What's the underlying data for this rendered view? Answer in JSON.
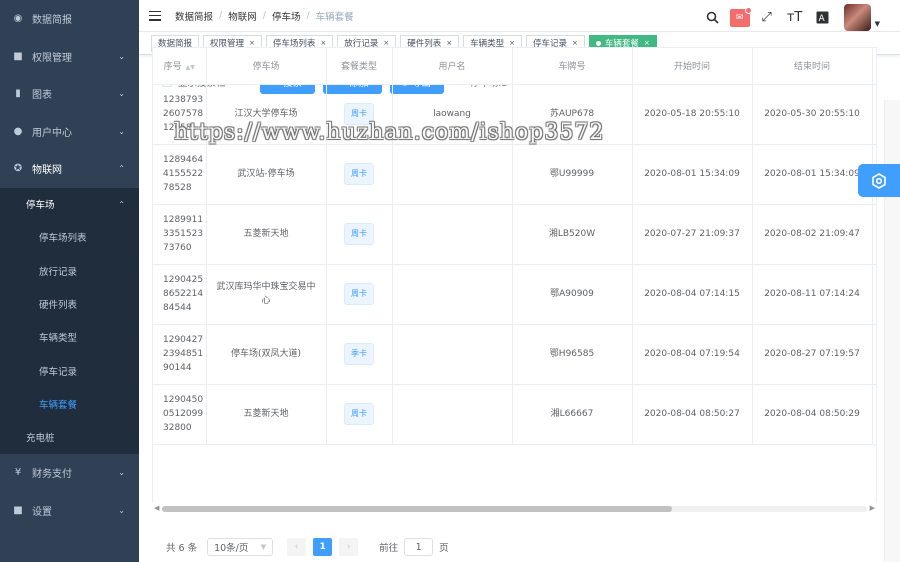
{
  "sidebar": {
    "items": [
      {
        "label": "数据简报",
        "icon": "dashboard-icon"
      },
      {
        "label": "权限管理",
        "icon": "lock-icon"
      },
      {
        "label": "图表",
        "icon": "chart-icon"
      },
      {
        "label": "用户中心",
        "icon": "user-icon"
      },
      {
        "label": "物联网",
        "icon": "iot-icon"
      }
    ],
    "parking_group": {
      "label": "停车场",
      "children": [
        "停车场列表",
        "放行记录",
        "硬件列表",
        "车辆类型",
        "停车记录",
        "车辆套餐"
      ],
      "active": "车辆套餐"
    },
    "charging": "充电桩",
    "bottom": [
      {
        "label": "财务支付",
        "icon": "yen-icon"
      },
      {
        "label": "设置",
        "icon": "settings-icon"
      }
    ]
  },
  "breadcrumb": [
    "数据简报",
    "物联网",
    "停车场",
    "车辆套餐"
  ],
  "tags": [
    "数据简报",
    "权限管理",
    "停车场列表",
    "放行记录",
    "硬件列表",
    "车辆类型",
    "停车记录",
    "车辆套餐"
  ],
  "toolbar": {
    "show_search": "显示搜索栏",
    "search": "搜索",
    "add": "添加",
    "export": "导出",
    "parkid": "停车场id"
  },
  "watermark": "https://www.huzhan.com/ishop3572",
  "table": {
    "headers": [
      "序号",
      "停车场",
      "套餐类型",
      "用户名",
      "车牌号",
      "开始时间",
      "结束时间"
    ],
    "rows": [
      {
        "id": [
          "1238793",
          "2607578",
          "12658"
        ],
        "park": "江汉大学停车场",
        "type": "周卡",
        "user": "laowang",
        "plate": "苏AUP678",
        "start": "2020-05-18 20:55:10",
        "end": "2020-05-30 20:55:10"
      },
      {
        "id": [
          "1289464",
          "4155522",
          "78528"
        ],
        "park": "武汉站-停车场",
        "type": "周卡",
        "user": "",
        "plate": "鄂U99999",
        "start": "2020-08-01 15:34:09",
        "end": "2020-08-01 15:34:09"
      },
      {
        "id": [
          "1289911",
          "3351523",
          "73760"
        ],
        "park": "五菱新天地",
        "type": "周卡",
        "user": "",
        "plate": "湘LB520W",
        "start": "2020-07-27 21:09:37",
        "end": "2020-08-02 21:09:47"
      },
      {
        "id": [
          "1290425",
          "8652214",
          "84544"
        ],
        "park": "武汉库玛华中珠宝交易中心",
        "type": "周卡",
        "user": "",
        "plate": "鄂A90909",
        "start": "2020-08-04 07:14:15",
        "end": "2020-08-11 07:14:24"
      },
      {
        "id": [
          "1290427",
          "2394851",
          "90144"
        ],
        "park": "停车场(双凤大道)",
        "type": "季卡",
        "user": "",
        "plate": "鄂H96585",
        "start": "2020-08-04 07:19:54",
        "end": "2020-08-27 07:19:57"
      },
      {
        "id": [
          "1290450",
          "0512099",
          "32800"
        ],
        "park": "五菱新天地",
        "type": "周卡",
        "user": "",
        "plate": "湘L66667",
        "start": "2020-08-04 08:50:27",
        "end": "2020-08-04 08:50:29"
      }
    ]
  },
  "pagination": {
    "total": "共 6 条",
    "page_size": "10条/页",
    "current": "1",
    "goto_label": "前往",
    "goto_value": "1",
    "page_suffix": "页"
  },
  "colors": {
    "sidebar_bg": "#304156",
    "primary": "#409eff",
    "active_tag": "#42b983"
  }
}
